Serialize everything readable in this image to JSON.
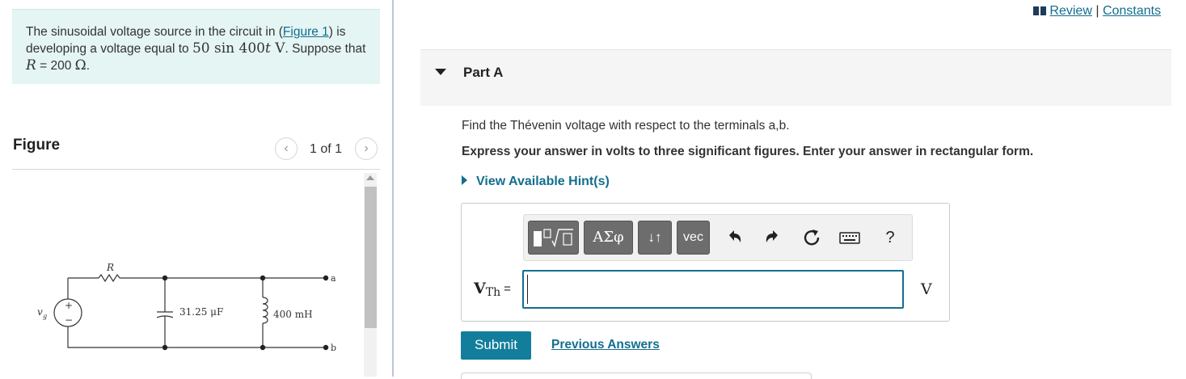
{
  "problem": {
    "text_before_link": "The sinusoidal voltage source in the circuit in (",
    "figure_link": "Figure 1",
    "text_after_link": ") is developing a voltage equal to ",
    "voltage_expr": "50 sin 400",
    "voltage_t": "t",
    "voltage_unit": " V",
    "text_suppose": ". Suppose that ",
    "r_symbol": "R",
    "r_value": " = 200 ",
    "ohm": "Ω",
    "period": "."
  },
  "figure": {
    "title": "Figure",
    "counter": "1 of 1",
    "prev_icon": "chevron-left-icon",
    "next_icon": "chevron-right-icon",
    "labels": {
      "resistor": "R",
      "source": "v",
      "source_sub": "g",
      "capacitor": "31.25 μF",
      "inductor": "400 mH",
      "terminal_a": "a",
      "terminal_b": "b",
      "plus": "+",
      "minus": "−"
    }
  },
  "header": {
    "review": "Review",
    "separator": "|",
    "constants": "Constants"
  },
  "part_a": {
    "title": "Part A",
    "question": "Find the Thévenin voltage with respect to the terminals a,b.",
    "instructions": "Express your answer in volts to three significant figures. Enter your answer in rectangular form.",
    "hint": "View Available Hint(s)"
  },
  "toolbar": {
    "greek": "ΑΣφ",
    "arrows": "↓↑",
    "vec": "vec",
    "help": "?"
  },
  "answer": {
    "var_main": "V",
    "var_sub": "Th",
    "equals": "=",
    "value": "",
    "unit": "V"
  },
  "buttons": {
    "submit": "Submit",
    "previous_answers": "Previous Answers"
  }
}
